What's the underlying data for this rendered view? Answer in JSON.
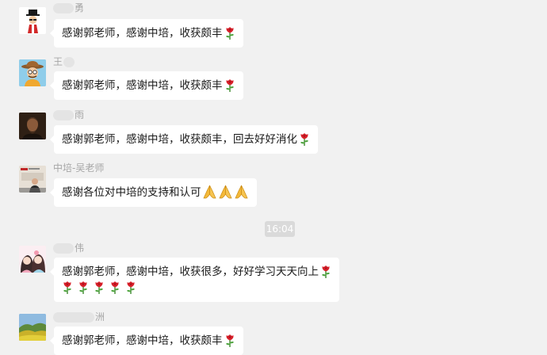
{
  "messages": [
    {
      "name": "勇",
      "text": "感谢郭老师，感谢中培，收获颇丰"
    },
    {
      "name": "王",
      "text": "感谢郭老师，感谢中培，收获颇丰"
    },
    {
      "name": "雨",
      "text": "感谢郭老师，感谢中培，收获颇丰，回去好好消化"
    },
    {
      "name": "中培-吴老师",
      "text": "感谢各位对中培的支持和认可"
    },
    {
      "name": "伟",
      "text": "感谢郭老师，感谢中培，收获很多，好好学习天天向上"
    },
    {
      "name": "洲",
      "text": "感谢郭老师，感谢中培，收获颇丰"
    }
  ],
  "timestamp": "16:04",
  "icons": {
    "rose": "rose-emoji-icon",
    "pray": "praying-hands-emoji-icon"
  },
  "colors": {
    "background": "#f1f1f1",
    "bubble": "#ffffff",
    "name_text": "#a6a6a6",
    "timestamp_bg": "#dadada"
  }
}
